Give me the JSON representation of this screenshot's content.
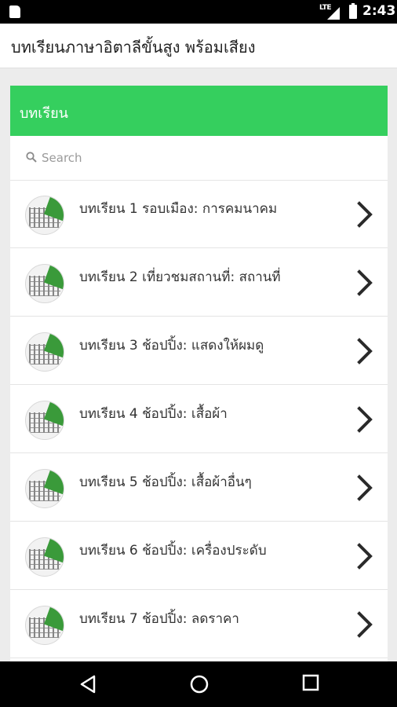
{
  "status_bar": {
    "network": "LTE",
    "time": "2:43",
    "icons": [
      "sd-card-icon",
      "signal-icon",
      "battery-icon"
    ]
  },
  "app_bar": {
    "title": "บทเรียนภาษาอิตาลีขั้นสูง พร้อมเสียง"
  },
  "card": {
    "header_title": "บทเรียน",
    "accent_color": "#35cf5e"
  },
  "search": {
    "placeholder": "Search",
    "value": ""
  },
  "lessons": [
    {
      "label": "บทเรียน 1 รอบเมือง: การคมนาคม",
      "icon": "colosseum-thumbnail",
      "action_icon": "chevron-right-icon"
    },
    {
      "label": "บทเรียน 2 เที่ยวชมสถานที่: สถานที่",
      "icon": "colosseum-thumbnail",
      "action_icon": "chevron-right-icon"
    },
    {
      "label": "บทเรียน 3 ช้อปปิ้ง: แสดงให้ผมดู",
      "icon": "colosseum-thumbnail",
      "action_icon": "chevron-right-icon"
    },
    {
      "label": "บทเรียน 4 ช้อปปิ้ง: เสื้อผ้า",
      "icon": "colosseum-thumbnail",
      "action_icon": "chevron-right-icon"
    },
    {
      "label": "บทเรียน 5 ช้อปปิ้ง: เสื้อผ้าอื่นๆ",
      "icon": "colosseum-thumbnail",
      "action_icon": "chevron-right-icon"
    },
    {
      "label": "บทเรียน 6 ช้อปปิ้ง: เครื่องประดับ",
      "icon": "colosseum-thumbnail",
      "action_icon": "chevron-right-icon"
    },
    {
      "label": "บทเรียน 7 ช้อปปิ้ง: ลดราคา",
      "icon": "colosseum-thumbnail",
      "action_icon": "chevron-right-icon"
    }
  ],
  "nav_bar": {
    "buttons": [
      "back-icon",
      "home-icon",
      "recents-icon"
    ]
  }
}
